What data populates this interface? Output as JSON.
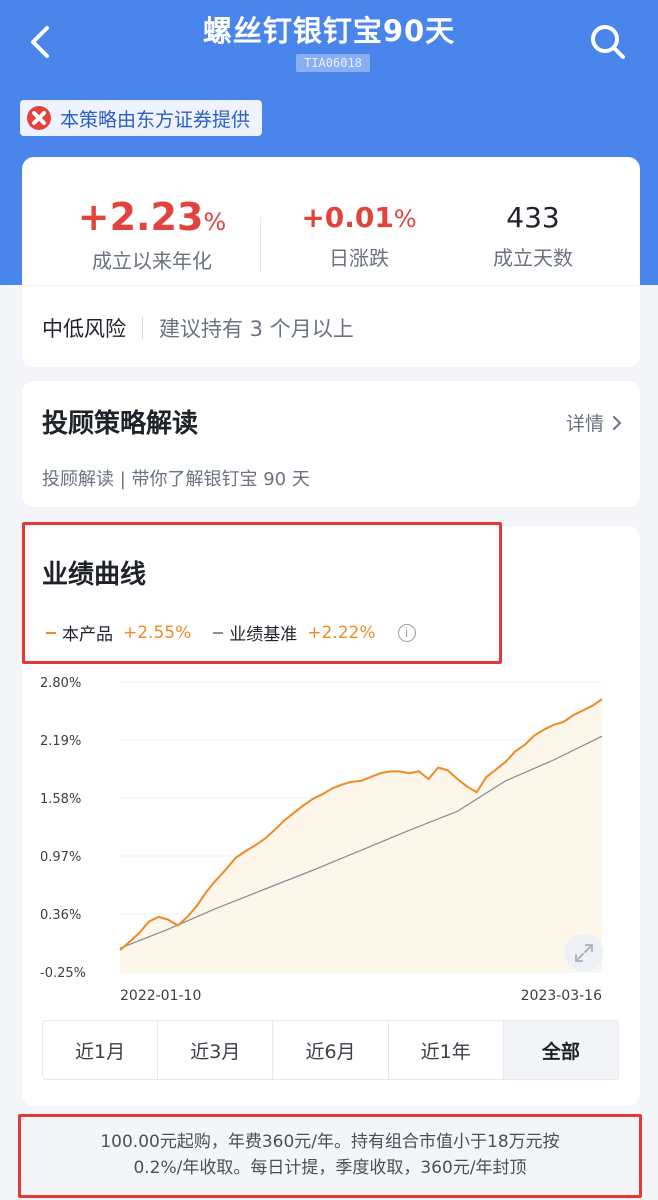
{
  "header": {
    "title": "螺丝钉银钉宝90天",
    "code": "TIA06018",
    "back_icon": "chevron-left-icon",
    "search_icon": "search-icon"
  },
  "provider": {
    "label": "本策略由东方证券提供",
    "logo_icon": "provider-logo-icon"
  },
  "stats": {
    "annualized": {
      "value": "+2.23",
      "unit": "%",
      "label": "成立以来年化"
    },
    "daily": {
      "value": "+0.01",
      "unit": "%",
      "label": "日涨跌"
    },
    "days": {
      "value": "433",
      "label": "成立天数"
    },
    "risk_level": "中低风险",
    "hold_tip": "建议持有 3 个月以上"
  },
  "interpretation": {
    "title": "投顾策略解读",
    "more_label": "详情",
    "desc": "投顾解读 | 带你了解银钉宝 90 天"
  },
  "performance": {
    "title": "业绩曲线",
    "legend": [
      {
        "name": "本产品",
        "value": "+2.55%",
        "color": "#f08a24"
      },
      {
        "name": "业绩基准",
        "value": "+2.22%",
        "color": "#8a9099"
      }
    ],
    "info_icon": "info-icon",
    "expand_icon": "expand-icon",
    "start_date": "2022-01-10",
    "end_date": "2023-03-16",
    "ranges": [
      "近1月",
      "近3月",
      "近6月",
      "近1年",
      "全部"
    ],
    "active_range": "全部"
  },
  "chart_data": {
    "type": "line",
    "y_ticks": [
      "2.80%",
      "2.19%",
      "1.58%",
      "0.97%",
      "0.36%",
      "-0.25%"
    ],
    "ylim": [
      -0.25,
      2.8
    ],
    "x_start": "2022-01-10",
    "x_end": "2023-03-16",
    "series": [
      {
        "name": "本产品",
        "color": "#f08a24",
        "x_frac": [
          0,
          0.02,
          0.04,
          0.06,
          0.08,
          0.1,
          0.12,
          0.14,
          0.16,
          0.18,
          0.2,
          0.22,
          0.24,
          0.26,
          0.28,
          0.3,
          0.32,
          0.34,
          0.36,
          0.38,
          0.4,
          0.42,
          0.44,
          0.46,
          0.48,
          0.5,
          0.52,
          0.54,
          0.56,
          0.58,
          0.6,
          0.62,
          0.64,
          0.66,
          0.68,
          0.7,
          0.72,
          0.74,
          0.76,
          0.78,
          0.8,
          0.82,
          0.84,
          0.86,
          0.88,
          0.9,
          0.92,
          0.94,
          0.96,
          0.98,
          1.0
        ],
        "values": [
          -0.02,
          0.07,
          0.16,
          0.28,
          0.33,
          0.3,
          0.24,
          0.33,
          0.45,
          0.6,
          0.72,
          0.83,
          0.95,
          1.02,
          1.08,
          1.15,
          1.24,
          1.34,
          1.42,
          1.5,
          1.57,
          1.62,
          1.68,
          1.72,
          1.75,
          1.76,
          1.8,
          1.84,
          1.86,
          1.86,
          1.84,
          1.86,
          1.78,
          1.9,
          1.87,
          1.78,
          1.7,
          1.64,
          1.8,
          1.88,
          1.96,
          2.07,
          2.14,
          2.24,
          2.3,
          2.35,
          2.38,
          2.45,
          2.5,
          2.55,
          2.62
        ]
      },
      {
        "name": "业绩基准",
        "color": "#8a9099",
        "x_frac": [
          0,
          0.1,
          0.2,
          0.3,
          0.4,
          0.5,
          0.6,
          0.7,
          0.8,
          0.9,
          1.0
        ],
        "values": [
          0.0,
          0.2,
          0.42,
          0.62,
          0.82,
          1.03,
          1.24,
          1.44,
          1.76,
          1.98,
          2.23
        ]
      }
    ]
  },
  "fee": {
    "line1": "100.00元起购，年费360元/年。持有组合市值小于18万元按",
    "line2": "0.2%/年收取。每日计提，季度收取，360元/年封顶"
  }
}
